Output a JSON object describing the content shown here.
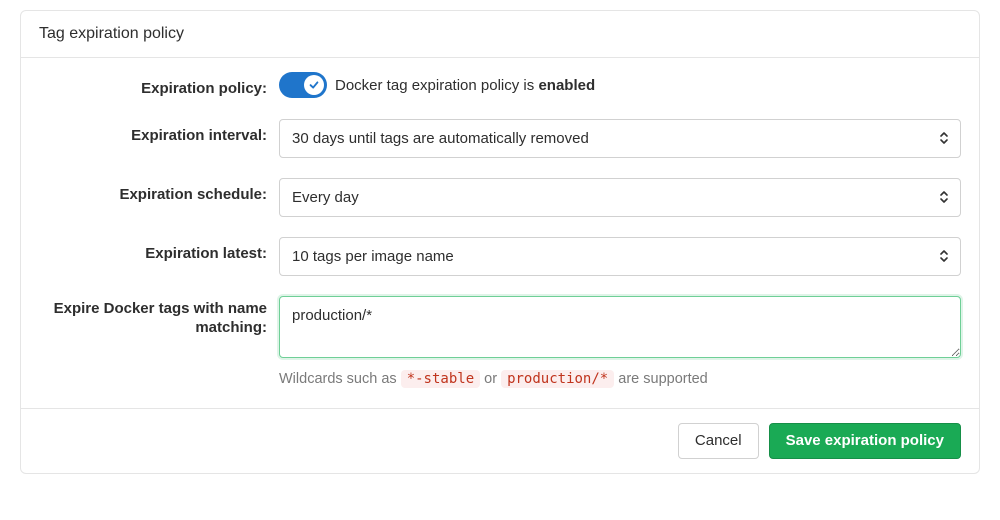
{
  "panel": {
    "title": "Tag expiration policy"
  },
  "policy": {
    "label": "Expiration policy:",
    "caption_prefix": "Docker tag expiration policy is ",
    "caption_state": "enabled"
  },
  "interval": {
    "label": "Expiration interval:",
    "value": "30 days until tags are automatically removed"
  },
  "schedule": {
    "label": "Expiration schedule:",
    "value": "Every day"
  },
  "latest": {
    "label": "Expiration latest:",
    "value": "10 tags per image name"
  },
  "match": {
    "label": "Expire Docker tags with name matching:",
    "value": "production/*",
    "help_prefix": "Wildcards such as ",
    "help_ex1": "*-stable",
    "help_mid": " or ",
    "help_ex2": "production/*",
    "help_suffix": " are supported"
  },
  "footer": {
    "cancel": "Cancel",
    "save": "Save expiration policy"
  }
}
